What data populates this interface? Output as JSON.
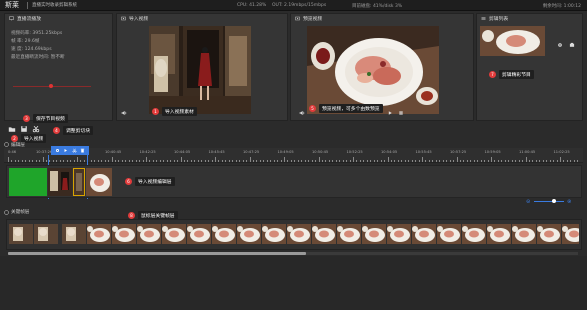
{
  "topbar": {
    "brand": "斯莱",
    "subtitle": "直播实时收录剪辑系统",
    "cpu": "CPU: 41.28%",
    "out": "OUT: 2.19mbps/15mbps",
    "disk": "目前磁盘: 41%/disk 3%",
    "time": "剩余时间: 1:00:12"
  },
  "live": {
    "title": "直播流播放",
    "bitrate": "视频码率: 3951.25kbps",
    "fps": "帧    率: 29.6帧",
    "speed": "速    度: 124.69kbps",
    "status": "最近直播断流时间: 暂不断"
  },
  "import_panel": {
    "title": "导入视频"
  },
  "preview_panel": {
    "title": "预览视频"
  },
  "clips_panel": {
    "title": "剪辑列表"
  },
  "callouts": {
    "c1": {
      "num": "1",
      "text": "导入视频素材"
    },
    "c2": {
      "num": "2",
      "text": "导入视频"
    },
    "c3": {
      "num": "3",
      "text": "保存节目视频"
    },
    "c4": {
      "num": "4",
      "text": "调整剪切块"
    },
    "c5": {
      "num": "5",
      "text": "预览视频，可多个由数预览"
    },
    "c6": {
      "num": "6",
      "text": "导入视频编辑层"
    },
    "c7": {
      "num": "7",
      "text": "剪辑精彩节目"
    },
    "c8": {
      "num": "8",
      "text": "鼠标层关键帧层"
    }
  },
  "timeline": {
    "edit_title": "编辑层",
    "keyframe_title": "关键帧层",
    "start_label": "0:46",
    "ticks": [
      "10:37:26",
      "10:39:06",
      "10:40:45",
      "10:42:25",
      "10:44:05",
      "10:45:45",
      "10:47:25",
      "10:49:05",
      "10:50:45",
      "10:52:25",
      "10:54:05",
      "10:55:45",
      "10:57:25",
      "10:59:05",
      "11:00:45",
      "11:02:25"
    ],
    "kf_times": [
      "10:36:35",
      "10:36:37",
      "10:39:35"
    ]
  },
  "colors": {
    "accent_blue": "#3a7be0",
    "callout_red": "#e23b3b",
    "green_clip": "#1fa52a"
  }
}
